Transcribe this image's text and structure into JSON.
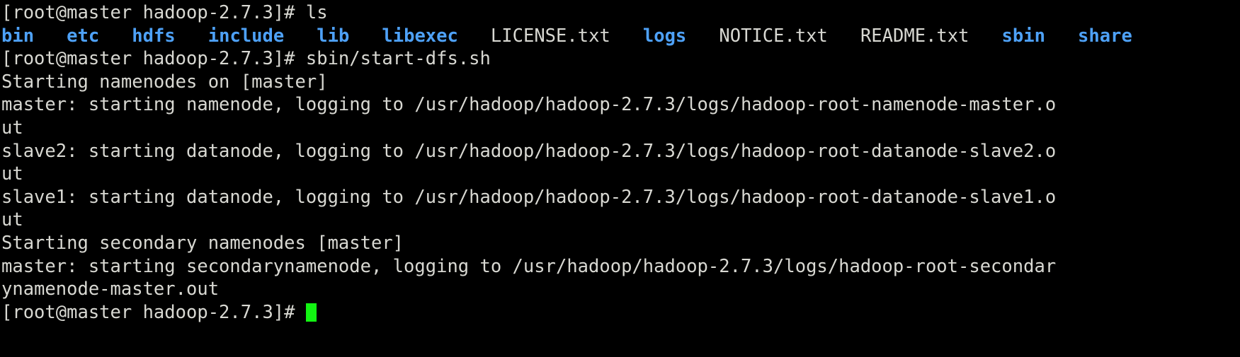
{
  "terminal": {
    "background_color": "#000000",
    "foreground_color": "#d8d8d2",
    "directory_color": "#4ea1f7",
    "cursor_color": "#12f412",
    "prompt": "[root@master hadoop-2.7.3]# ",
    "lines": [
      {
        "id": "line-1-prompt-ls",
        "type": "prompt",
        "segments": [
          {
            "text": "[root@master hadoop-2.7.3]# ",
            "color": "default",
            "name": "shell-prompt"
          },
          {
            "text": "ls",
            "color": "default",
            "name": "command-ls"
          }
        ]
      },
      {
        "id": "line-2-ls-output",
        "type": "output",
        "segments": [
          {
            "text": "bin",
            "color": "dir",
            "name": "dir-bin"
          },
          {
            "text": "   ",
            "color": "default",
            "name": "spacer"
          },
          {
            "text": "etc",
            "color": "dir",
            "name": "dir-etc"
          },
          {
            "text": "   ",
            "color": "default",
            "name": "spacer"
          },
          {
            "text": "hdfs",
            "color": "dir",
            "name": "dir-hdfs"
          },
          {
            "text": "   ",
            "color": "default",
            "name": "spacer"
          },
          {
            "text": "include",
            "color": "dir",
            "name": "dir-include"
          },
          {
            "text": "   ",
            "color": "default",
            "name": "spacer"
          },
          {
            "text": "lib",
            "color": "dir",
            "name": "dir-lib"
          },
          {
            "text": "   ",
            "color": "default",
            "name": "spacer"
          },
          {
            "text": "libexec",
            "color": "dir",
            "name": "dir-libexec"
          },
          {
            "text": "   ",
            "color": "default",
            "name": "spacer"
          },
          {
            "text": "LICENSE.txt",
            "color": "file",
            "name": "file-license-txt"
          },
          {
            "text": "   ",
            "color": "default",
            "name": "spacer"
          },
          {
            "text": "logs",
            "color": "dir",
            "name": "dir-logs"
          },
          {
            "text": "   ",
            "color": "default",
            "name": "spacer"
          },
          {
            "text": "NOTICE.txt",
            "color": "file",
            "name": "file-notice-txt"
          },
          {
            "text": "   ",
            "color": "default",
            "name": "spacer"
          },
          {
            "text": "README.txt",
            "color": "file",
            "name": "file-readme-txt"
          },
          {
            "text": "   ",
            "color": "default",
            "name": "spacer"
          },
          {
            "text": "sbin",
            "color": "dir",
            "name": "dir-sbin"
          },
          {
            "text": "   ",
            "color": "default",
            "name": "spacer"
          },
          {
            "text": "share",
            "color": "dir",
            "name": "dir-share"
          }
        ]
      },
      {
        "id": "line-3-prompt-startdfs",
        "type": "prompt",
        "segments": [
          {
            "text": "[root@master hadoop-2.7.3]# ",
            "color": "default",
            "name": "shell-prompt"
          },
          {
            "text": "sbin/start-dfs.sh",
            "color": "default",
            "name": "command-start-dfs"
          }
        ]
      },
      {
        "id": "line-4",
        "type": "output",
        "segments": [
          {
            "text": "Starting namenodes on [master]",
            "color": "default",
            "name": "log-starting-namenodes"
          }
        ]
      },
      {
        "id": "line-5",
        "type": "output",
        "segments": [
          {
            "text": "master: starting namenode, logging to /usr/hadoop/hadoop-2.7.3/logs/hadoop-root-namenode-master.o",
            "color": "default",
            "name": "log-namenode-master"
          }
        ]
      },
      {
        "id": "line-6",
        "type": "output",
        "segments": [
          {
            "text": "ut",
            "color": "default",
            "name": "log-wrap-continuation"
          }
        ]
      },
      {
        "id": "line-7",
        "type": "output",
        "segments": [
          {
            "text": "slave2: starting datanode, logging to /usr/hadoop/hadoop-2.7.3/logs/hadoop-root-datanode-slave2.o",
            "color": "default",
            "name": "log-datanode-slave2"
          }
        ]
      },
      {
        "id": "line-8",
        "type": "output",
        "segments": [
          {
            "text": "ut",
            "color": "default",
            "name": "log-wrap-continuation"
          }
        ]
      },
      {
        "id": "line-9",
        "type": "output",
        "segments": [
          {
            "text": "slave1: starting datanode, logging to /usr/hadoop/hadoop-2.7.3/logs/hadoop-root-datanode-slave1.o",
            "color": "default",
            "name": "log-datanode-slave1"
          }
        ]
      },
      {
        "id": "line-10",
        "type": "output",
        "segments": [
          {
            "text": "ut",
            "color": "default",
            "name": "log-wrap-continuation"
          }
        ]
      },
      {
        "id": "line-11",
        "type": "output",
        "segments": [
          {
            "text": "Starting secondary namenodes [master]",
            "color": "default",
            "name": "log-starting-secondary-namenodes"
          }
        ]
      },
      {
        "id": "line-12",
        "type": "output",
        "segments": [
          {
            "text": "master: starting secondarynamenode, logging to /usr/hadoop/hadoop-2.7.3/logs/hadoop-root-secondar",
            "color": "default",
            "name": "log-secondarynamenode-master"
          }
        ]
      },
      {
        "id": "line-13",
        "type": "output",
        "segments": [
          {
            "text": "ynamenode-master.out",
            "color": "default",
            "name": "log-wrap-continuation"
          }
        ]
      },
      {
        "id": "line-14-final-prompt",
        "type": "prompt-cursor",
        "segments": [
          {
            "text": "[root@master hadoop-2.7.3]# ",
            "color": "default",
            "name": "shell-prompt"
          }
        ],
        "cursor": true
      }
    ]
  }
}
